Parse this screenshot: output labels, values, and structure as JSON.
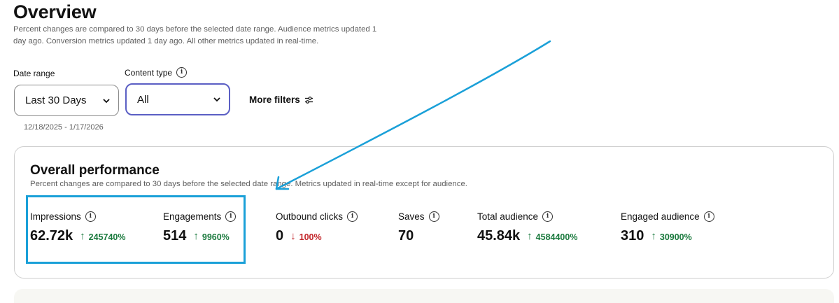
{
  "page": {
    "title": "Overview",
    "subtitle": "Percent changes are compared to 30 days before the selected date range. Audience metrics updated 1 day ago. Conversion metrics updated 1 day ago. All other metrics updated in real-time."
  },
  "filters": {
    "date_range_label": "Date range",
    "date_range_value": "Last 30 Days",
    "content_type_label": "Content type",
    "content_type_value": "All",
    "more_filters_label": "More filters",
    "date_range_text": "12/18/2025 - 1/17/2026"
  },
  "performance": {
    "title": "Overall performance",
    "subtitle": "Percent changes are compared to 30 days before the selected date range. Metrics updated in real-time except for audience.",
    "metrics": [
      {
        "label": "Impressions",
        "value": "62.72k",
        "change": "245740%",
        "direction": "up",
        "has_info": true
      },
      {
        "label": "Engagements",
        "value": "514",
        "change": "9960%",
        "direction": "up",
        "has_info": true
      },
      {
        "label": "Outbound clicks",
        "value": "0",
        "change": "100%",
        "direction": "down",
        "has_info": true
      },
      {
        "label": "Saves",
        "value": "70",
        "change": "",
        "direction": "none",
        "has_info": true
      },
      {
        "label": "Total audience",
        "value": "45.84k",
        "change": "4584400%",
        "direction": "up",
        "has_info": true
      },
      {
        "label": "Engaged audience",
        "value": "310",
        "change": "30900%",
        "direction": "up",
        "has_info": true
      }
    ]
  },
  "icons": {
    "info": "info-icon",
    "chevron": "chevron-down-icon",
    "filters": "sliders-icon",
    "up": "arrow-up-icon",
    "down": "arrow-down-icon"
  },
  "colors": {
    "positive": "#1b7a3e",
    "negative": "#c3262a",
    "annotation": "#1aa0d8",
    "active_border": "#5b5fc4"
  }
}
